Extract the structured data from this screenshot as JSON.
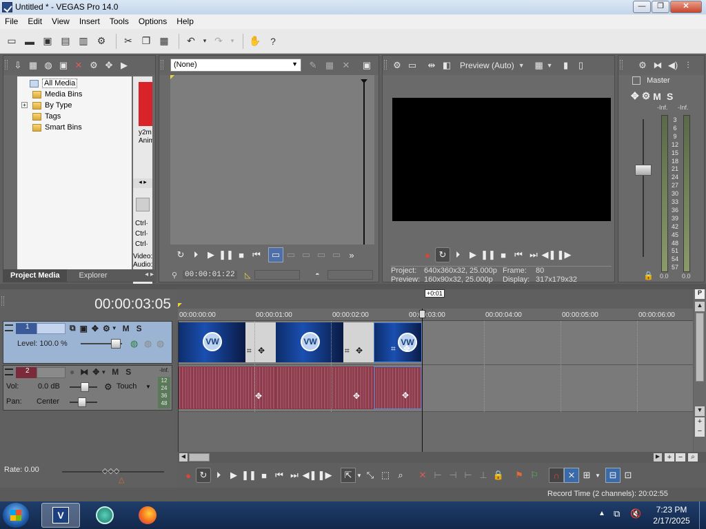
{
  "window": {
    "title": "Untitled * - VEGAS Pro 14.0"
  },
  "menu": [
    "File",
    "Edit",
    "View",
    "Insert",
    "Tools",
    "Options",
    "Help"
  ],
  "media_panel": {
    "tree": [
      "All Media",
      "Media Bins",
      "By Type",
      "Tags",
      "Smart Bins"
    ],
    "thumb_caption_1": "y2m",
    "thumb_caption_2": "Anim",
    "ctrl_lines": [
      "Ctrl·",
      "Ctrl·",
      "Ctrl·"
    ],
    "video_label": "Video:",
    "audio_label": "Audio:",
    "tabs": [
      "Project Media",
      "Explorer"
    ]
  },
  "trimmer": {
    "dropdown_value": "(None)",
    "timecode": "00:00:01:22"
  },
  "preview": {
    "quality": "Preview (Auto)",
    "project_label": "Project:",
    "project_value": "640x360x32, 25.000p",
    "preview_label": "Preview:",
    "preview_value": "160x90x32, 25.000p",
    "frame_label": "Frame:",
    "frame_value": "80",
    "display_label": "Display:",
    "display_value": "317x179x32"
  },
  "mixer": {
    "master_label": "Master",
    "inf_left": "-Inf.",
    "inf_right": "-Inf.",
    "scale": [
      "3",
      "6",
      "9",
      "12",
      "15",
      "18",
      "21",
      "24",
      "27",
      "30",
      "33",
      "36",
      "39",
      "42",
      "45",
      "48",
      "51",
      "54",
      "57"
    ],
    "bottom_left": "0.0",
    "bottom_right": "0.0"
  },
  "timeline": {
    "cursor_time": "00:00:03:05",
    "marker_label": "+0:01",
    "ruler": [
      "00:00:00:00",
      "00:00:01:00",
      "00:00:02:00",
      "00:00:03:00",
      "00:00:04:00",
      "00:00:05:00",
      "00:00:06:00"
    ],
    "video_track": {
      "number": "1",
      "level_label": "Level: 100.0 %"
    },
    "audio_track": {
      "number": "2",
      "vol_label": "Vol:",
      "vol_value": "0.0 dB",
      "pan_label": "Pan:",
      "pan_value": "Center",
      "automation": "Touch",
      "meter_top": "-Inf.",
      "meter_scale": [
        "12",
        "24",
        "36",
        "48"
      ]
    },
    "m_label": "M",
    "s_label": "S"
  },
  "transport": {
    "rate_label": "Rate: 0.00"
  },
  "status": {
    "record_time": "Record Time (2 channels): 20:02:55"
  },
  "taskbar": {
    "time": "7:23 PM",
    "date": "2/17/2025"
  }
}
